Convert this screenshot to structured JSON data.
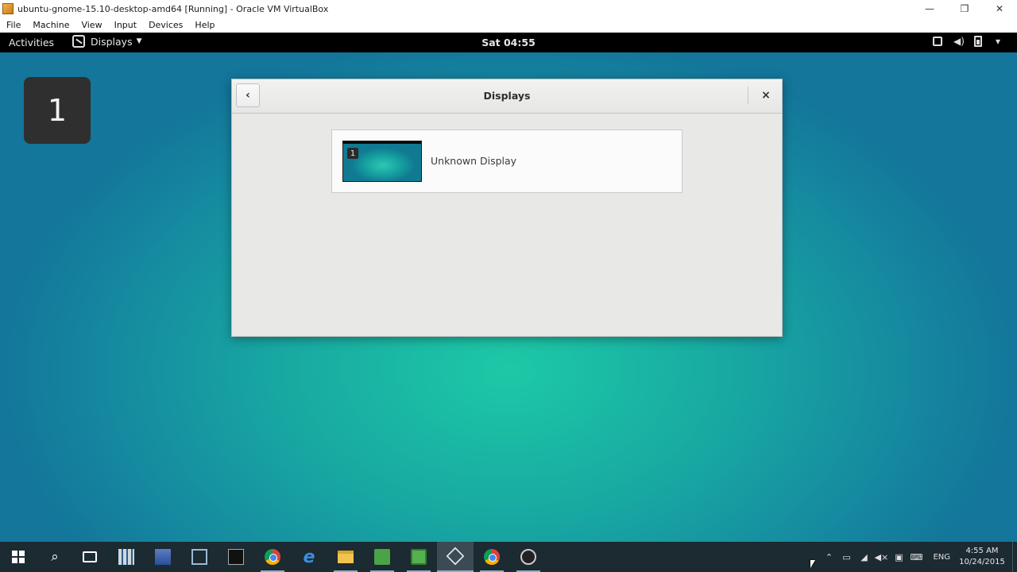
{
  "vbox": {
    "title": "ubuntu-gnome-15.10-desktop-amd64 [Running] - Oracle VM VirtualBox",
    "menu": [
      "File",
      "Machine",
      "View",
      "Input",
      "Devices",
      "Help"
    ],
    "controls": {
      "minimize": "—",
      "restore": "❐",
      "close": "✕"
    }
  },
  "gnome": {
    "activities": "Activities",
    "app_menu": "Displays",
    "clock": "Sat 04:55"
  },
  "desktop": {
    "monitor_badge": "1"
  },
  "dialog": {
    "title": "Displays",
    "back_icon": "‹",
    "close_icon": "×",
    "displays": [
      {
        "number": "1",
        "name": "Unknown Display"
      }
    ]
  },
  "taskbar": {
    "apps": [
      "start",
      "search",
      "task-view",
      "calculator",
      "admin-tools",
      "network-tool",
      "terminal",
      "chrome",
      "edge",
      "file-explorer",
      "green-app",
      "green-app-2",
      "virtualbox",
      "chrome-2",
      "obs"
    ],
    "language": "ENG",
    "time": "4:55 AM",
    "date": "10/24/2015"
  }
}
